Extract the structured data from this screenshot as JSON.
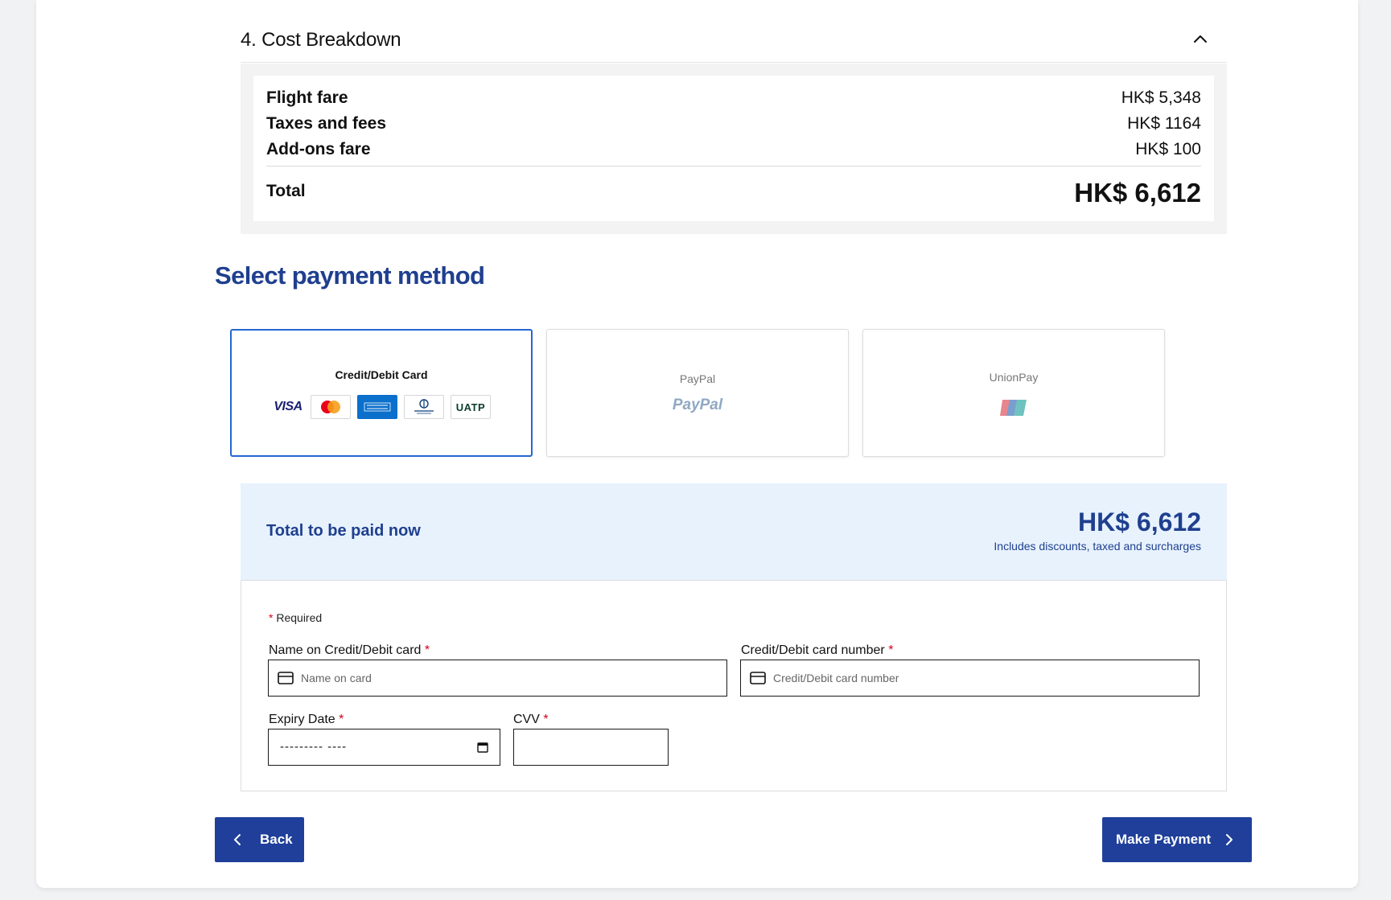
{
  "cost_breakdown": {
    "title": "4. Cost Breakdown",
    "collapse_icon": "chevron-up-icon",
    "rows": [
      {
        "label": "Flight fare",
        "value": "HK$ 5,348"
      },
      {
        "label": "Taxes and fees",
        "value": "HK$ 1164"
      },
      {
        "label": "Add-ons fare",
        "value": "HK$ 100"
      }
    ],
    "total_label": "Total",
    "total_value": "HK$ 6,612"
  },
  "payment": {
    "title": "Select payment method",
    "options": [
      {
        "label": "Credit/Debit Card",
        "selected": true,
        "brands": [
          "VISA",
          "mastercard",
          "American Express",
          "Diners Club",
          "UATP"
        ]
      },
      {
        "label": "PayPal",
        "selected": false,
        "logo_text": "PayPal"
      },
      {
        "label": "UnionPay",
        "selected": false
      }
    ]
  },
  "total_banner": {
    "label": "Total to be paid now",
    "amount": "HK$ 6,612",
    "note": "Includes discounts, taxed and surcharges"
  },
  "form": {
    "required_note": "Required",
    "required_marker": "*",
    "name_label": "Name on Credit/Debit card",
    "name_placeholder": "Name on card",
    "number_label": "Credit/Debit card number",
    "number_placeholder": "Credit/Debit card number",
    "expiry_label": "Expiry Date",
    "expiry_value": "--------- ----",
    "cvv_label": "CVV"
  },
  "buttons": {
    "back": "Back",
    "pay": "Make Payment"
  },
  "colors": {
    "brand_blue": "#1f3f9a",
    "heading_blue": "#1f3f8f",
    "selected_border": "#2566d3",
    "banner_bg": "#e7f2fd",
    "required_red": "#d0021b"
  }
}
